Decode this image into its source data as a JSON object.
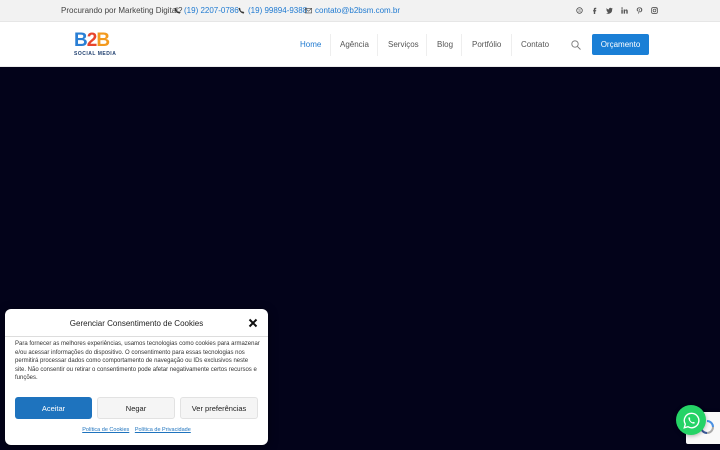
{
  "topbar": {
    "question": "Procurando por Marketing Digital?",
    "phone1": "(19) 2207-0786",
    "phone2": "(19) 99894-9388",
    "email": "contato@b2bsm.com.br",
    "social_icons": [
      "skype-icon",
      "facebook-icon",
      "twitter-icon",
      "linkedin-icon",
      "pinterest-icon",
      "instagram-icon"
    ]
  },
  "header": {
    "logo_text": "B2B",
    "logo_subtitle": "SOCIAL MEDIA",
    "nav": [
      "Home",
      "Agência",
      "Serviços",
      "Blog",
      "Portfólio",
      "Contato"
    ],
    "active_nav": "Home",
    "cta_label": "Orçamento"
  },
  "cookie_modal": {
    "title": "Gerenciar Consentimento de Cookies",
    "description": "Para fornecer as melhores experiências, usamos tecnologias como cookies para armazenar e/ou acessar informações do dispositivo. O consentimento para essas tecnologias nos permitirá processar dados como comportamento de navegação ou IDs exclusivos neste site. Não consentir ou retirar o consentimento pode afetar negativamente certos recursos e funções.",
    "accept_label": "Aceitar",
    "deny_label": "Negar",
    "prefs_label": "Ver preferências",
    "link_cookies": "Política de Cookies",
    "link_privacy": "Política de Privacidade"
  },
  "colors": {
    "accent": "#1f7ad1",
    "hero_bg": "#03031a",
    "whatsapp": "#25d366"
  }
}
